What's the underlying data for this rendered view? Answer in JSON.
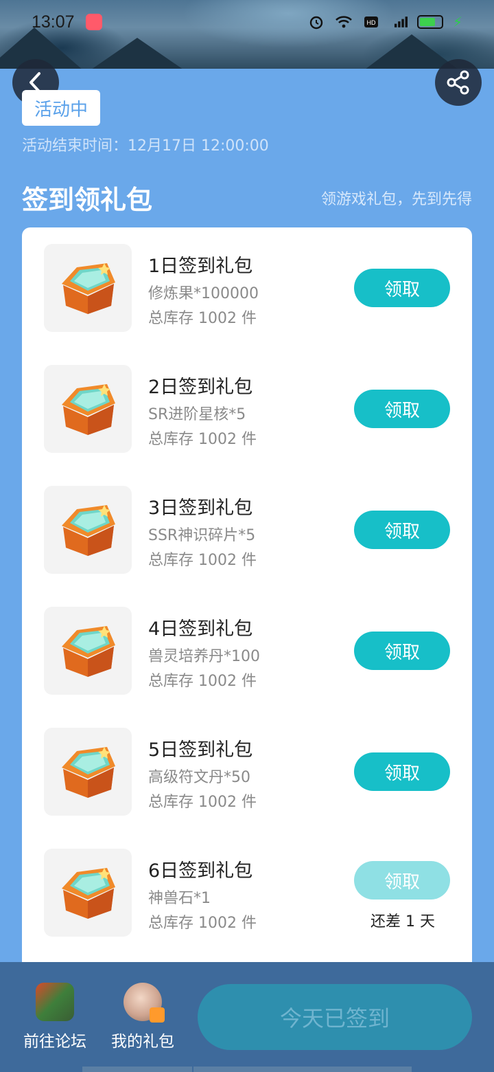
{
  "status_bar": {
    "time": "13:07",
    "icons": [
      "alarm-icon",
      "wifi-icon",
      "hd-icon",
      "signal-4g-icon",
      "battery-icon",
      "charging-icon"
    ]
  },
  "header": {
    "back_icon": "chevron-left-icon",
    "share_icon": "share-icon"
  },
  "activity": {
    "badge": "活动中",
    "end_time": "活动结束时间：12月17日 12:00:00"
  },
  "section": {
    "title": "签到领礼包",
    "subtitle": "领游戏礼包，先到先得"
  },
  "gifts": [
    {
      "name": "1日签到礼包",
      "content": "修炼果*100000",
      "stock": "总库存 1002 件",
      "button": "领取",
      "enabled": true
    },
    {
      "name": "2日签到礼包",
      "content": "SR进阶星核*5",
      "stock": "总库存 1002 件",
      "button": "领取",
      "enabled": true
    },
    {
      "name": "3日签到礼包",
      "content": "SSR神识碎片*5",
      "stock": "总库存 1002 件",
      "button": "领取",
      "enabled": true
    },
    {
      "name": "4日签到礼包",
      "content": "兽灵培养丹*100",
      "stock": "总库存 1002 件",
      "button": "领取",
      "enabled": true
    },
    {
      "name": "5日签到礼包",
      "content": "高级符文丹*50",
      "stock": "总库存 1002 件",
      "button": "领取",
      "enabled": true
    },
    {
      "name": "6日签到礼包",
      "content": "神兽石*1",
      "stock": "总库存 1002 件",
      "button": "领取",
      "enabled": false,
      "remain": "还差 1 天"
    }
  ],
  "bottom": {
    "forum_label": "前往论坛",
    "mygift_label": "我的礼包",
    "signin_label": "今天已签到"
  },
  "colors": {
    "page_bg": "#6aa8ea",
    "accent": "#17bfc8",
    "accent_disabled": "#8fe0e4",
    "bottom_bar": "#3e6a9b"
  }
}
